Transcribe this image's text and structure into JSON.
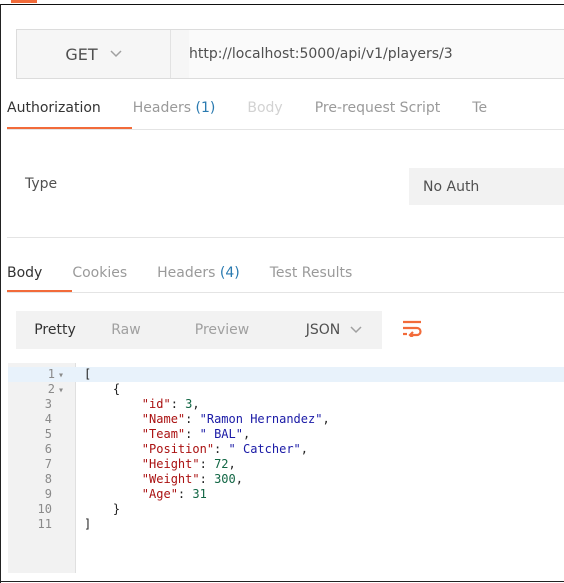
{
  "request": {
    "method": "GET",
    "url": "http://localhost:5000/api/v1/players/3"
  },
  "request_tabs": [
    {
      "label": "Authorization",
      "count": "",
      "state": "active"
    },
    {
      "label": "Headers",
      "count": "(1)",
      "state": "normal"
    },
    {
      "label": "Body",
      "count": "",
      "state": "disabled"
    },
    {
      "label": "Pre-request Script",
      "count": "",
      "state": "normal"
    },
    {
      "label": "Te",
      "count": "",
      "state": "normal"
    }
  ],
  "auth": {
    "type_label": "Type",
    "type_value": "No Auth"
  },
  "response_tabs": [
    {
      "label": "Body",
      "count": "",
      "state": "active"
    },
    {
      "label": "Cookies",
      "count": "",
      "state": "normal"
    },
    {
      "label": "Headers",
      "count": "(4)",
      "state": "normal"
    },
    {
      "label": "Test Results",
      "count": "",
      "state": "normal"
    }
  ],
  "response_toolbar": {
    "formats": [
      "Pretty",
      "Raw",
      "Preview"
    ],
    "active_format": "Pretty",
    "language": "JSON",
    "wrap_icon": "wrap-lines-icon"
  },
  "editor": {
    "lines": [
      {
        "n": "1",
        "fold": "▾",
        "text": "["
      },
      {
        "n": "2",
        "fold": "▾",
        "text": "    {"
      },
      {
        "n": "3",
        "fold": "",
        "text": "        \"id\": 3,"
      },
      {
        "n": "4",
        "fold": "",
        "text": "        \"Name\": \"Ramon Hernandez\","
      },
      {
        "n": "5",
        "fold": "",
        "text": "        \"Team\": \" BAL\","
      },
      {
        "n": "6",
        "fold": "",
        "text": "        \"Position\": \" Catcher\","
      },
      {
        "n": "7",
        "fold": "",
        "text": "        \"Height\": 72,"
      },
      {
        "n": "8",
        "fold": "",
        "text": "        \"Weight\": 300,"
      },
      {
        "n": "9",
        "fold": "",
        "text": "        \"Age\": 31"
      },
      {
        "n": "10",
        "fold": "",
        "text": "    }"
      },
      {
        "n": "11",
        "fold": "",
        "text": "]"
      }
    ]
  },
  "colors": {
    "accent": "#f26b3a",
    "count": "#2a7ab0"
  }
}
